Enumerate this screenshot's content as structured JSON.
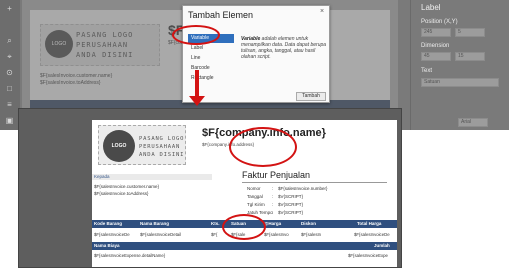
{
  "background": {
    "toolbar_icons": [
      "+",
      "⌕",
      "⌖",
      "⊙",
      "□",
      "≡",
      "▣",
      "◐"
    ],
    "logo_circle": "LOGO",
    "logo_lines": [
      "PASANG LOGO",
      "PERUSAHAAN",
      "ANDA DISINI"
    ],
    "company_name": "$F{compan",
    "company_address": "$F{company.info.address}",
    "address_lines": [
      "$F{salesInvoice.customer.name}",
      "$F{salesInvoice.toAddress}"
    ]
  },
  "properties": {
    "title": "Label",
    "position_label": "Position (X,Y)",
    "position_x": "245",
    "position_y": "5",
    "dimension_label": "Dimension",
    "width": "45",
    "height": "15",
    "text_label": "Text",
    "text_value": "Satuan",
    "font_label": "Arial"
  },
  "modal": {
    "title": "Tambah Elemen",
    "close": "×",
    "items": [
      "Variable",
      "Label",
      "Line",
      "Barcode",
      "Rectangle"
    ],
    "selected": "Variable",
    "description_bold": "Variable",
    "description": " adalah elemen untuk menampilkan data. Data dapat berupa tulisan, angka, tanggal, atau hasil olahan script.",
    "add_button": "Tambah"
  },
  "zoom": {
    "logo_circle": "LOGO",
    "logo_lines": [
      "PASANG LOGO",
      "PERUSAHAAN",
      "ANDA DISINI"
    ],
    "company_name": "$F{company.info.name}",
    "company_address": "$F{company.info.address}",
    "kepada": "Kepada",
    "customer_name": "$F{salesInvoice.customer.name}",
    "to_address": "$F{salesInvoice.toAddress}",
    "faktur_title": "Faktur Penjualan",
    "faktur_fields": [
      {
        "label": "Nomor",
        "value": "$F{salesInvoice.number}"
      },
      {
        "label": "Tanggal",
        "value": "$V{SCRIPT}"
      },
      {
        "label": "Tgl Kirim",
        "value": "$V{SCRIPT}"
      },
      {
        "label": "Jatuh Tempo",
        "value": "$V{SCRIPT}"
      }
    ],
    "table_headers": [
      "Kode Barang",
      "Nama Barang",
      "Kts.",
      "Satuan",
      "@Harga",
      "Diskon",
      "Total Harga"
    ],
    "table_row": [
      "$F{salesInvoiceDe",
      "$F{salesInvoiceDetail",
      "$F{",
      "$F{sale",
      "$F{salesInvo",
      "$F{salesIn",
      "$F{salesInvoiceDe"
    ],
    "expense_headers": [
      "Nama Biaya",
      "Jumlah"
    ],
    "expense_row": [
      "$F{salesInvoiceExpense.detailName}",
      "$F{salesInvoiceExpe"
    ]
  }
}
